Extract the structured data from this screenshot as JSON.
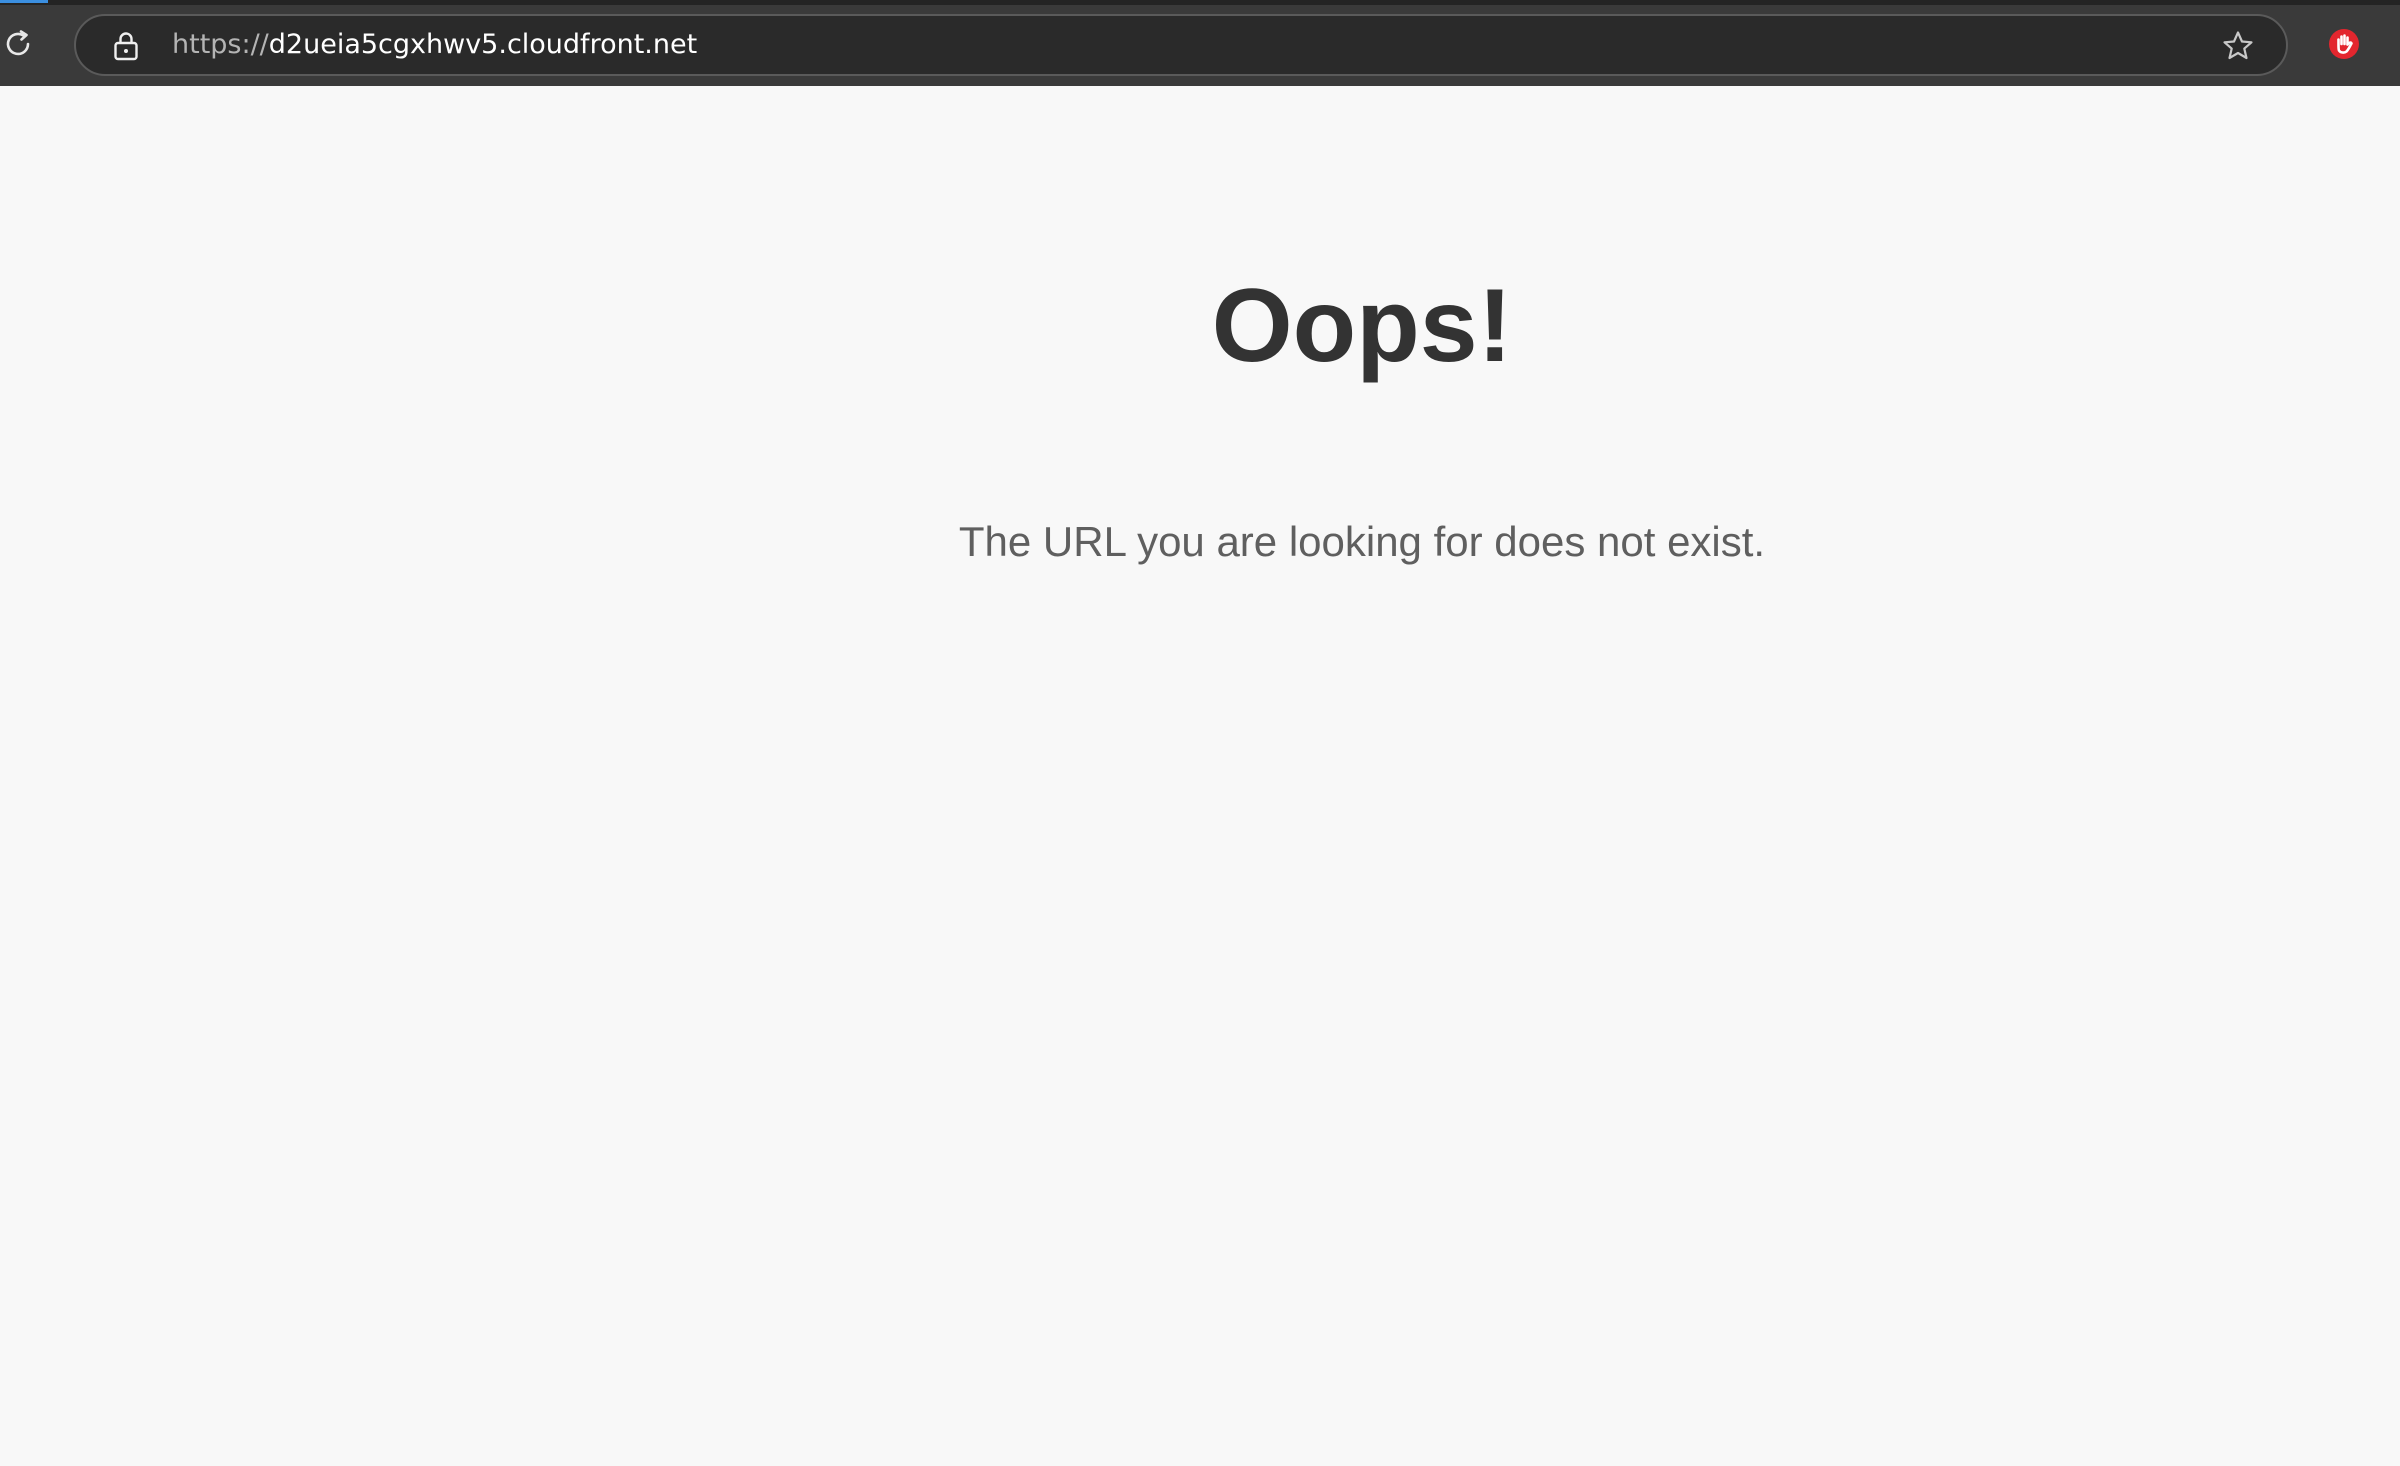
{
  "browser": {
    "url_scheme": "https://",
    "url_host": "d2ueia5cgxhwv5.cloudfront.net",
    "icons": {
      "reload": "reload-icon",
      "lock": "lock-icon",
      "bookmark": "star-icon",
      "extension": "stop-hand-icon"
    },
    "extension_color": "#e3262e"
  },
  "page": {
    "heading": "Oops!",
    "message": "The URL you are looking for does not exist."
  }
}
